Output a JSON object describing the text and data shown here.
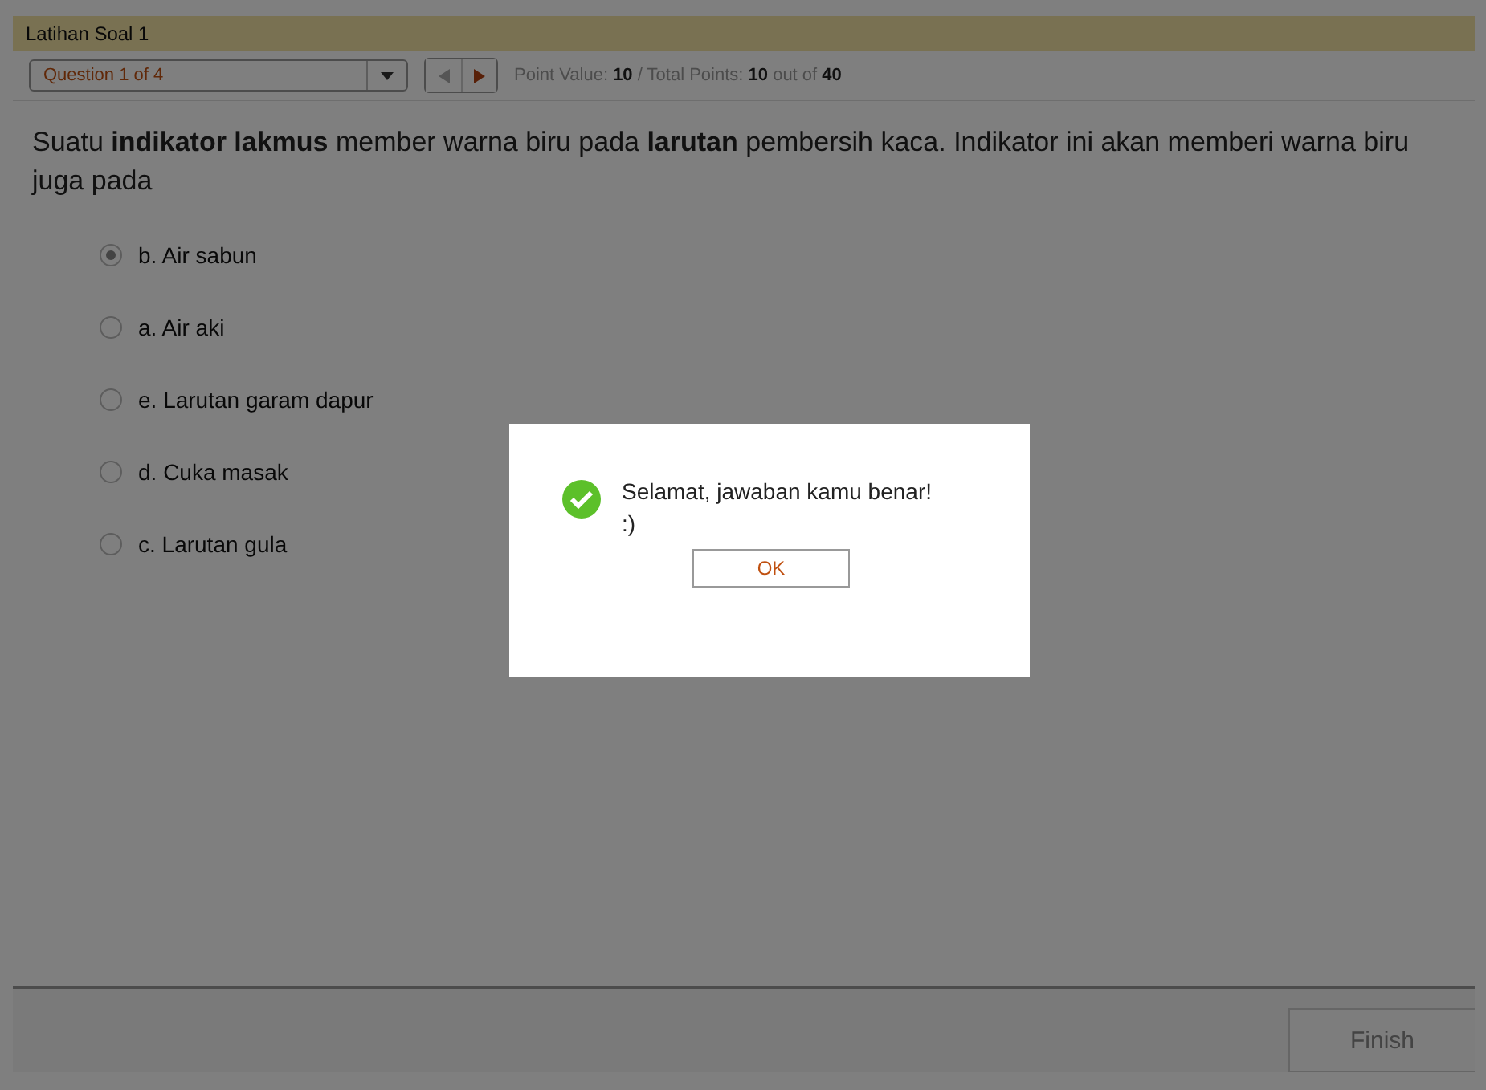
{
  "window": {
    "title": "Latihan Soal 1"
  },
  "toolbar": {
    "question_select": "Question 1 of 4",
    "points": "Point Value: **10** / Total Points: **10** out of **40**"
  },
  "question": {
    "text": "Suatu **indikator lakmus** member warna biru pada **larutan** pembersih kaca. Indikator ini akan memberi warna biru juga pada"
  },
  "options": [
    {
      "label": "b. Air sabun",
      "selected": true
    },
    {
      "label": "a. Air aki",
      "selected": false
    },
    {
      "label": "e. Larutan garam dapur",
      "selected": false
    },
    {
      "label": "d. Cuka masak",
      "selected": false
    },
    {
      "label": "c. Larutan gula",
      "selected": false
    }
  ],
  "dialog": {
    "message": "Selamat, jawaban kamu benar! :)",
    "button": "OK"
  },
  "footer": {
    "button": "Finish"
  }
}
